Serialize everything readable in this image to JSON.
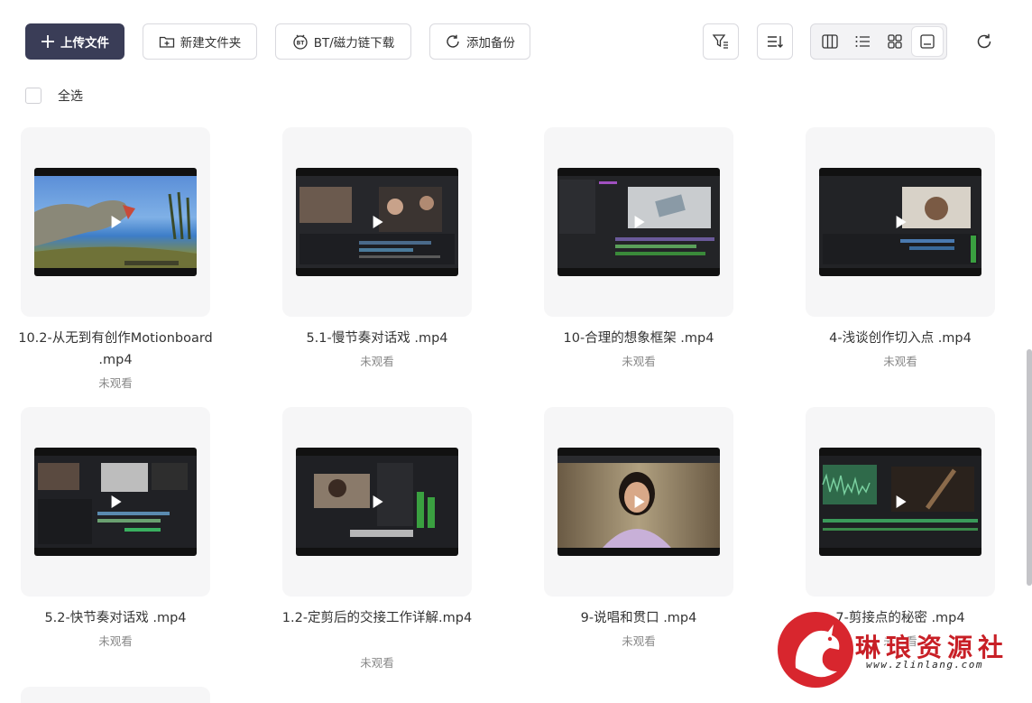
{
  "toolbar": {
    "upload_label": "上传文件",
    "new_folder_label": "新建文件夹",
    "bt_label": "BT/磁力链下载",
    "backup_label": "添加备份"
  },
  "selection": {
    "select_all_label": "全选"
  },
  "files": [
    {
      "title": "10.2-从无到有创作Motionboard .mp4",
      "status": "未观看",
      "thumb": "dinosaur"
    },
    {
      "title": "5.1-慢节奏对话戏 .mp4",
      "status": "未观看",
      "thumb": "editor"
    },
    {
      "title": "10-合理的想象框架 .mp4",
      "status": "未观看",
      "thumb": "editor"
    },
    {
      "title": "4-浅谈创作切入点 .mp4",
      "status": "未观看",
      "thumb": "editor"
    },
    {
      "title": "5.2-快节奏对话戏 .mp4",
      "status": "未观看",
      "thumb": "editor"
    },
    {
      "title": "1.2-定剪后的交接工作详解.mp4",
      "status": "未观看",
      "thumb": "editor"
    },
    {
      "title": "9-说唱和贯口 .mp4",
      "status": "未观看",
      "thumb": "portrait"
    },
    {
      "title": "7-剪接点的秘密 .mp4",
      "status": "未观看",
      "thumb": "editor"
    }
  ],
  "watermark": {
    "brand": "琳琅资源社",
    "url": "www.zlinlang.com"
  },
  "colors": {
    "primary": "#3a3d57",
    "card_bg": "#f6f6f7",
    "watermark_red": "#d8262e"
  }
}
